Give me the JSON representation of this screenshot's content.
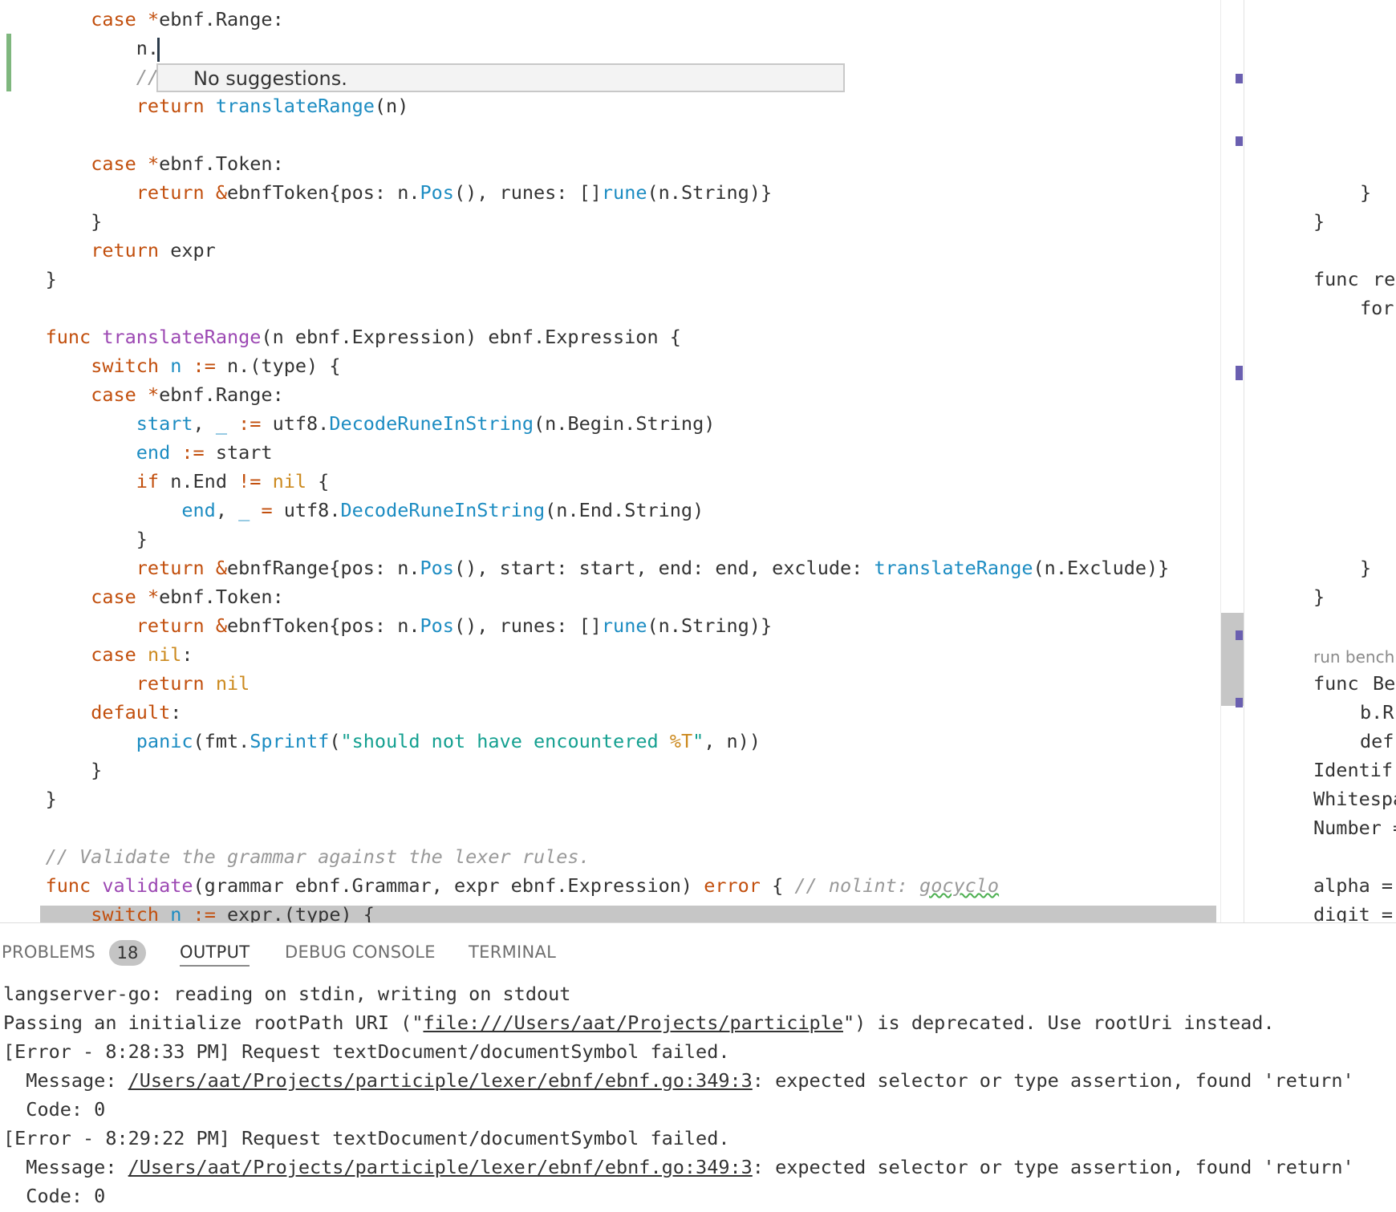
{
  "suggest": {
    "message": "No suggestions."
  },
  "panel": {
    "tabs": [
      {
        "label": "PROBLEMS"
      },
      {
        "label": "OUTPUT"
      },
      {
        "label": "DEBUG CONSOLE"
      },
      {
        "label": "TERMINAL"
      }
    ],
    "problem_count": "18",
    "output": {
      "line1": "langserver-go: reading on stdin, writing on stdout",
      "line2_a": "Passing an initialize rootPath URI (\"",
      "line2_link": "file:///Users/aat/Projects/participle",
      "line2_b": "\") is deprecated. Use rootUri instead.",
      "err1": "[Error - 8:28:33 PM] Request textDocument/documentSymbol failed.",
      "msg_label": "  Message: ",
      "msg_link": "/Users/aat/Projects/participle/lexer/ebnf/ebnf.go:349:3",
      "msg_rest": ": expected selector or type assertion, found 'return'",
      "code": "  Code: 0",
      "err2": "[Error - 8:29:22 PM] Request textDocument/documentSymbol failed."
    }
  },
  "right_pane": {
    "codelens": "run bench",
    "lines": [
      "}",
      "}",
      "func",
      "rea",
      "for",
      "}",
      "}",
      "func",
      "Ben",
      "b.R",
      "def",
      "Identif",
      "Whitespa",
      "Number =",
      "alpha =",
      "digit ="
    ]
  }
}
